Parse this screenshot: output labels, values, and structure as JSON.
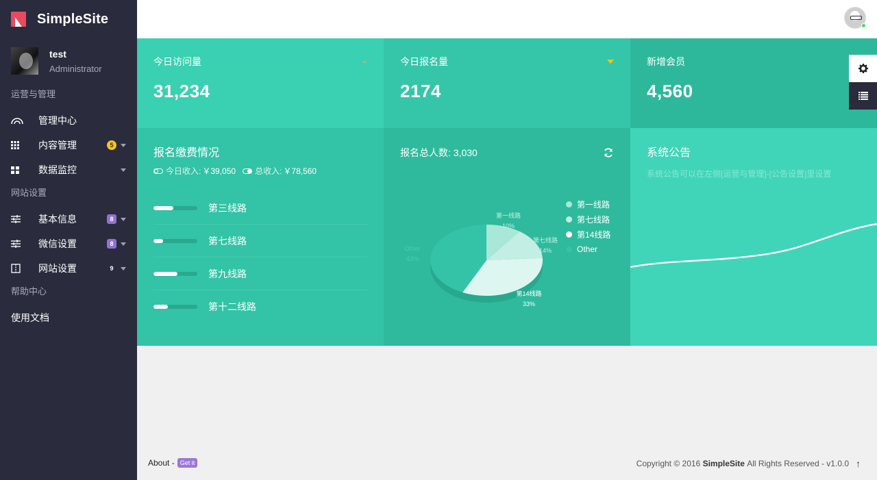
{
  "brand": {
    "name": "SimpleSite",
    "logo_colors": [
      "#e84a5f",
      "#ffffff"
    ]
  },
  "user": {
    "name": "test",
    "role": "Administrator"
  },
  "sidebar": {
    "section1": "运营与管理",
    "items1": [
      {
        "label": "管理中心",
        "icon": "dashboard-icon",
        "badge": "",
        "caret": false
      },
      {
        "label": "内容管理",
        "icon": "grid-icon",
        "badge": "5",
        "badge_style": "yellow",
        "caret": true
      },
      {
        "label": "数据监控",
        "icon": "blocks-icon",
        "badge": "",
        "caret": true
      }
    ],
    "section2": "网站设置",
    "items2": [
      {
        "label": "基本信息",
        "icon": "sliders-icon",
        "badge": "8",
        "badge_style": "purple",
        "caret": true
      },
      {
        "label": "微信设置",
        "icon": "sliders-icon",
        "badge": "8",
        "badge_style": "purple",
        "caret": true
      },
      {
        "label": "网站设置",
        "icon": "layout-icon",
        "badge": "9",
        "badge_style": "plain",
        "caret": true
      }
    ],
    "section3": "帮助中心",
    "doc_link": "使用文档"
  },
  "stats": [
    {
      "title": "今日访问量",
      "value": "31,234",
      "trend": "up",
      "color": "#3ad0b2"
    },
    {
      "title": "今日报名量",
      "value": "2174",
      "trend": "down",
      "color": "#35c6a9"
    },
    {
      "title": "新增会员",
      "value": "4,560",
      "trend": "",
      "color": "#2eb89b"
    }
  ],
  "payment": {
    "title": "报名缴费情况",
    "today_label": "今日收入:",
    "today_value": "￥39,050",
    "total_label": "总收入:",
    "total_value": "￥78,560",
    "lines": [
      {
        "label": "第三线路",
        "progress": 0.45
      },
      {
        "label": "第七线路",
        "progress": 0.22
      },
      {
        "label": "第九线路",
        "progress": 0.55
      },
      {
        "label": "第十二线路",
        "progress": 0.33
      }
    ]
  },
  "registrations": {
    "title": "报名总人数: 3,030",
    "chart_data": {
      "type": "pie",
      "title": "",
      "slices": [
        {
          "name": "第一线路",
          "value": 10,
          "label": "10%",
          "color": "#a9e7d8"
        },
        {
          "name": "第七线路",
          "value": 14,
          "label": "14%",
          "color": "#c3eee3"
        },
        {
          "name": "第14线路",
          "value": 33,
          "label": "33%",
          "color": "#def6f0"
        },
        {
          "name": "Other",
          "value": 43,
          "label": "43%",
          "color": "#34c3a6"
        }
      ],
      "legend": [
        "第一线路",
        "第七线路",
        "第14线路",
        "Other"
      ],
      "legend_position": "right"
    }
  },
  "notice": {
    "title": "系统公告",
    "text": "系统公告可以在左侧[运营与管理]-[公告设置]里设置"
  },
  "footer": {
    "about": "About -",
    "get_it": "Get it",
    "copyright_prefix": "Copyright © 2016",
    "brand": "SimpleSite",
    "copyright_suffix": "All Rights Reserved - v1.0.0",
    "up_arrow": "↑"
  }
}
